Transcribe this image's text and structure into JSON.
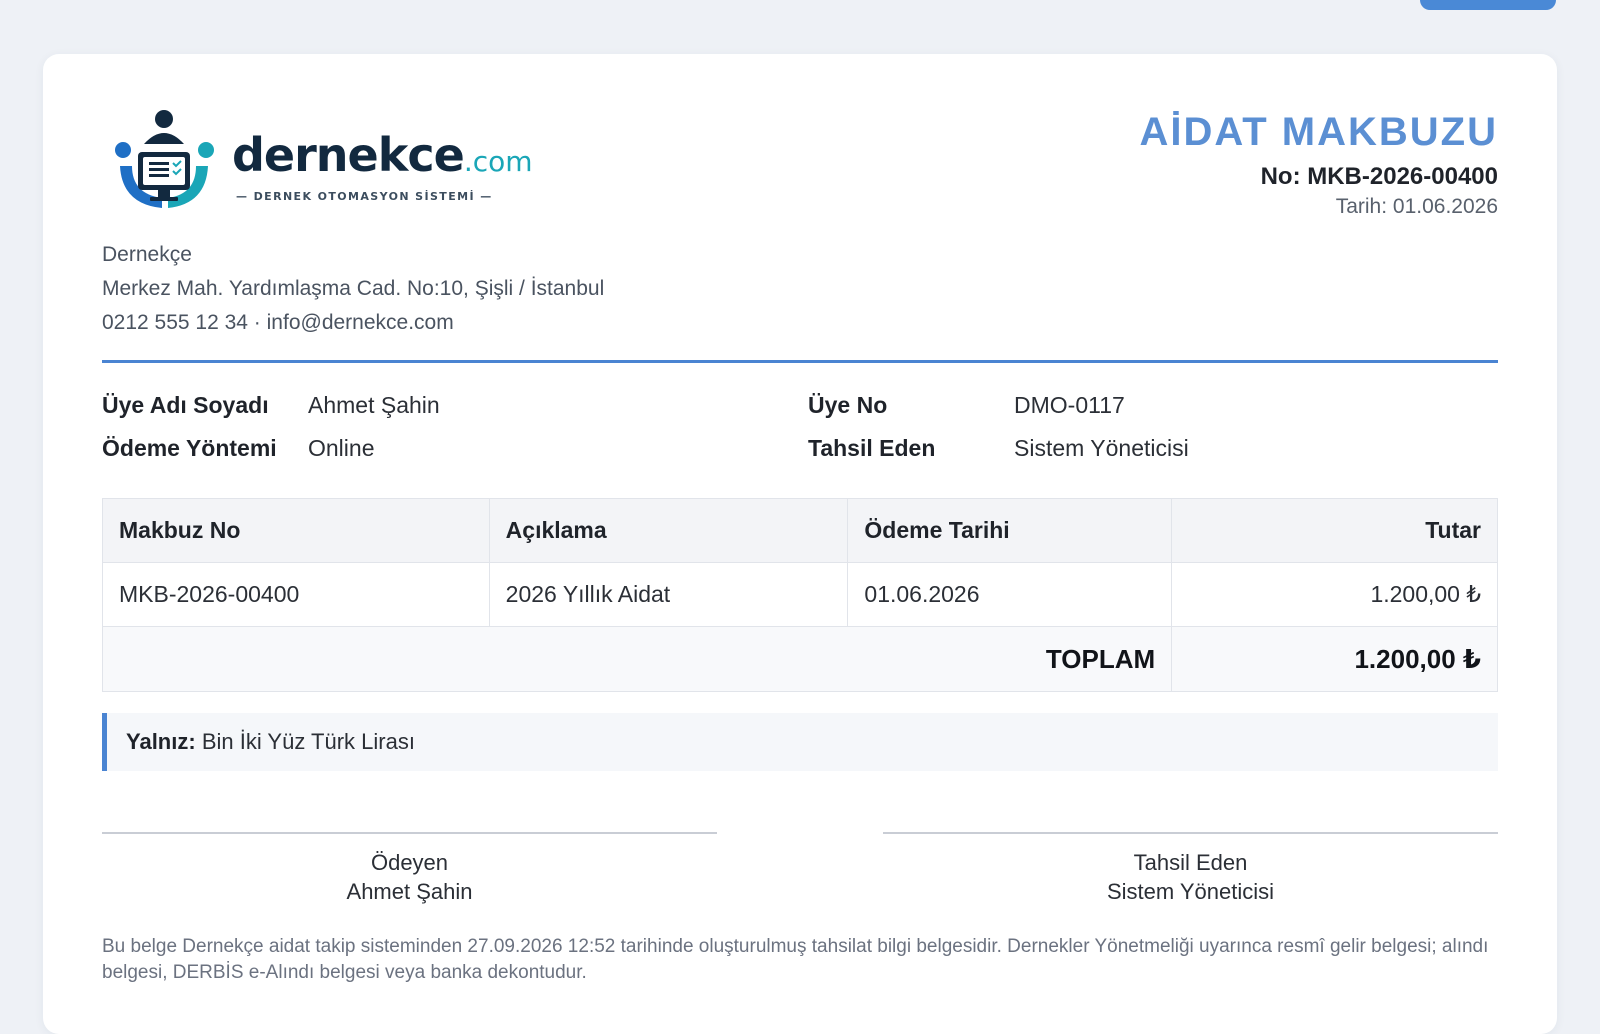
{
  "brand": {
    "name": "dernekce",
    "tld": ".com",
    "tagline": "— DERNEK OTOMASYON SİSTEMİ —",
    "colors": {
      "navy": "#12293f",
      "teal": "#1aa6b7",
      "blue": "#1f6fc5"
    }
  },
  "organization": {
    "name": "Dernekçe",
    "address": "Merkez Mah. Yardımlaşma Cad. No:10, Şişli / İstanbul",
    "contact": "0212 555 12 34 · info@dernekce.com"
  },
  "receipt": {
    "title": "AİDAT MAKBUZU",
    "number": "No: MKB-2026-00400",
    "date": "Tarih: 01.06.2026"
  },
  "member_info": {
    "name_label": "Üye Adı Soyadı",
    "name_value": "Ahmet Şahin",
    "member_no_label": "Üye No",
    "member_no_value": "DMO-0117",
    "payment_method_label": "Ödeme Yöntemi",
    "payment_method_value": "Online",
    "collector_label": "Tahsil Eden",
    "collector_value": "Sistem Yöneticisi"
  },
  "table": {
    "headers": [
      "Makbuz No",
      "Açıklama",
      "Ödeme Tarihi",
      "Tutar"
    ],
    "rows": [
      [
        "MKB-2026-00400",
        "2026 Yıllık Aidat",
        "01.06.2026",
        "1.200,00 ₺"
      ]
    ],
    "total_label": "TOPLAM",
    "total_value": "1.200,00 ₺"
  },
  "amount_in_words": {
    "label": "Yalnız:",
    "value": "Bin İki Yüz Türk Lirası"
  },
  "signatures": {
    "payer_role": "Ödeyen",
    "payer_name": "Ahmet Şahin",
    "collector_role": "Tahsil Eden",
    "collector_name": "Sistem Yöneticisi"
  },
  "footnote": "Bu belge Dernekçe aidat takip sisteminden 27.09.2026 12:52 tarihinde oluşturulmuş tahsilat bilgi belgesidir. Dernekler Yönetmeliği uyarınca resmî gelir belgesi; alındı belgesi, DERBİS e-Alındı belgesi veya banka dekontudur.",
  "accent_color": "#4a84d2"
}
